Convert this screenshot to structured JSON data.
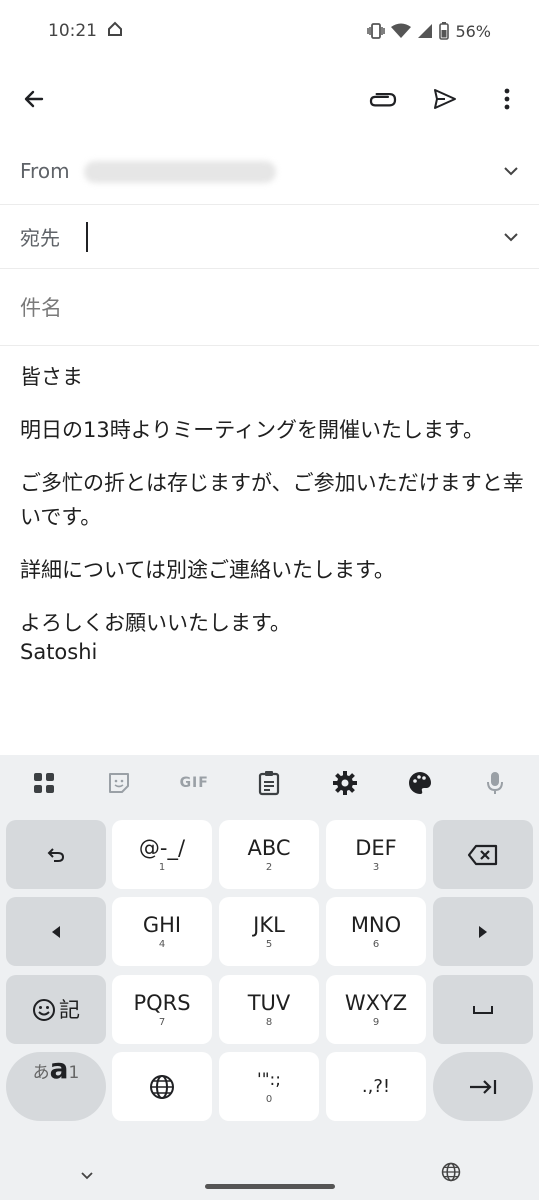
{
  "status_bar": {
    "time": "10:21",
    "battery": "56%",
    "icons": [
      "home-icon",
      "vibrate-icon",
      "wifi-icon",
      "signal-icon",
      "battery-icon"
    ]
  },
  "app_bar": {
    "icons": [
      "back-arrow-icon",
      "attach-icon",
      "send-icon",
      "more-vert-icon"
    ]
  },
  "compose": {
    "from_label": "From",
    "to_label": "宛先",
    "subject_placeholder": "件名"
  },
  "body": {
    "greeting": "皆さま",
    "line1": "明日の13時よりミーティングを開催いたします。",
    "line2": "ご多忙の折とは存じますが、ご参加いただけますと幸いです。",
    "line3": "詳細については別途ご連絡いたします。",
    "closing": "よろしくお願いいたします。",
    "signature": "Satoshi"
  },
  "keyboard": {
    "toolbar": [
      "apps-icon",
      "sticker-icon",
      "GIF",
      "clipboard-icon",
      "settings-icon",
      "palette-icon",
      "mic-icon"
    ],
    "gif_label": "GIF",
    "keys": {
      "k1_main": "@-_/",
      "k1_sub": "1",
      "k2_main": "ABC",
      "k2_sub": "2",
      "k3_main": "DEF",
      "k3_sub": "3",
      "k4_main": "GHI",
      "k4_sub": "4",
      "k5_main": "JKL",
      "k5_sub": "5",
      "k6_main": "MNO",
      "k6_sub": "6",
      "k7_main": "PQRS",
      "k7_sub": "7",
      "k8_main": "TUV",
      "k8_sub": "8",
      "k9_main": "WXYZ",
      "k9_sub": "9",
      "k0_main": "'\":;",
      "k0_sub": "0",
      "punct_main": ".,?!",
      "emoji_label": "記",
      "mode_label_a": "あ",
      "mode_label_b": "a",
      "mode_label_c": "1"
    },
    "accent_color": "#1f1f1f",
    "fn_key_color": "#d6d9dc"
  }
}
